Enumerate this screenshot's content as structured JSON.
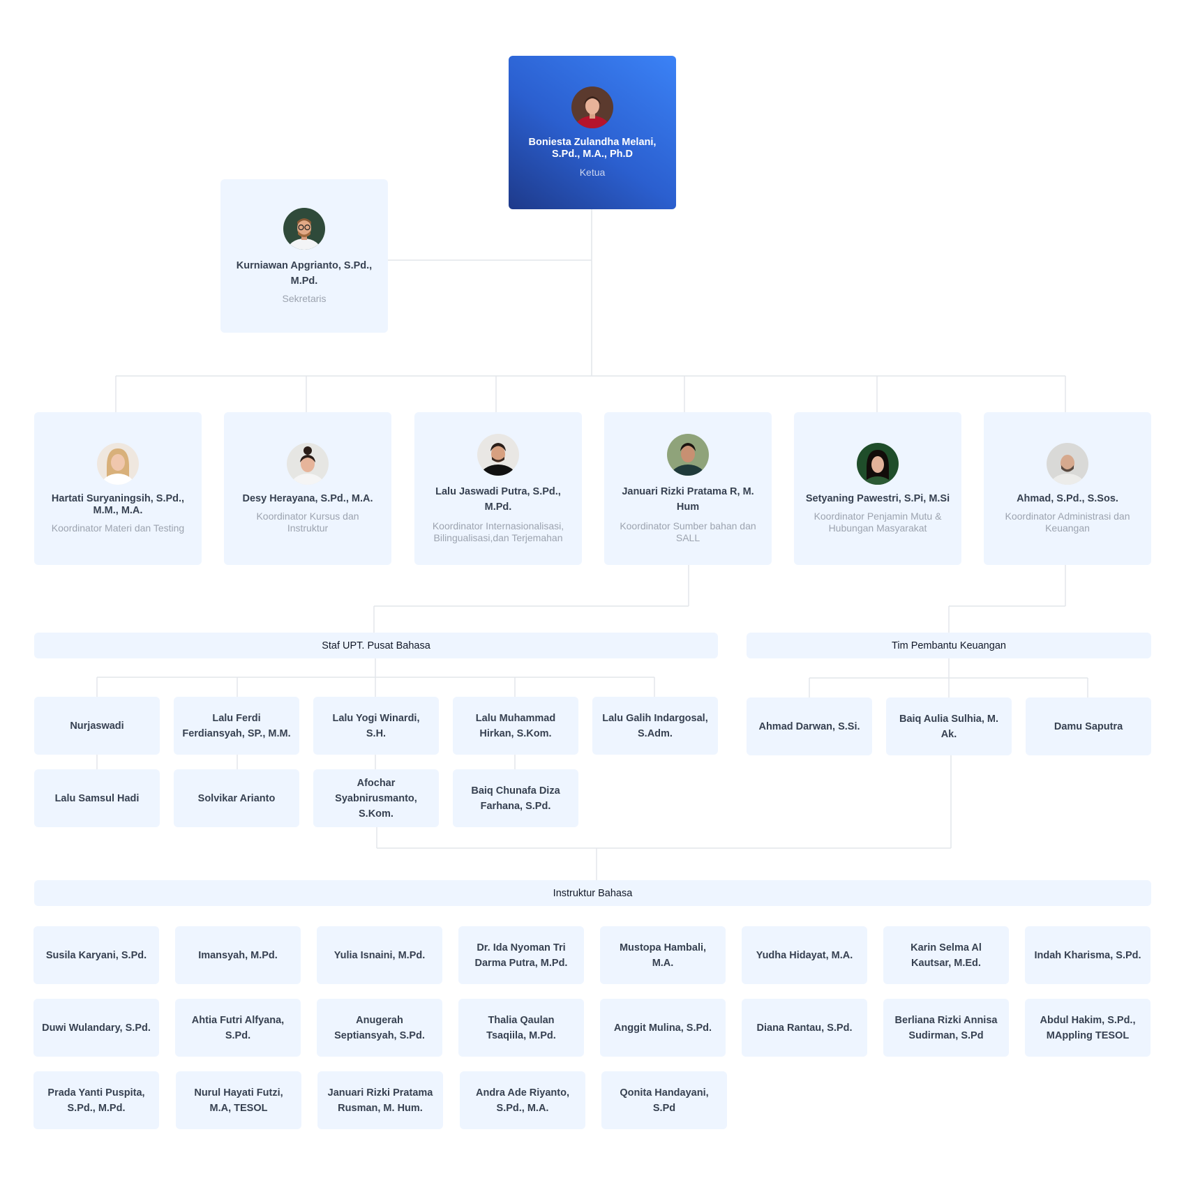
{
  "ketua": {
    "name": "Boniesta Zulandha Melani, S.Pd., M.A., Ph.D",
    "role": "Ketua",
    "avatar": "avatar-woman-red-top"
  },
  "sekretaris": {
    "name": "Kurniawan Apgrianto, S.Pd., M.Pd.",
    "role": "Sekretaris",
    "avatar": "avatar-man-glasses"
  },
  "koordinator": [
    {
      "name": "Hartati Suryaningsih, S.Pd., M.M., M.A.",
      "role": "Koordinator Materi dan Testing",
      "avatar": "avatar-woman-blonde"
    },
    {
      "name": "Desy Herayana, S.Pd., M.A.",
      "role": "Koordinator Kursus dan Instruktur",
      "avatar": "avatar-woman-bun"
    },
    {
      "name": "Lalu Jaswadi Putra, S.Pd., M.Pd.",
      "role": "Koordinator Internasionalisasi, Bilingualisasi,dan Terjemahan",
      "avatar": "avatar-man-black-shirt"
    },
    {
      "name": "Januari Rizki Pratama R, M. Hum",
      "role": "Koordinator Sumber bahan dan SALL",
      "avatar": "avatar-man-outdoor"
    },
    {
      "name": "Setyaning Pawestri, S.Pi, M.Si",
      "role": "Koordinator Penjamin Mutu & Hubungan Masyarakat",
      "avatar": "avatar-woman-leaves"
    },
    {
      "name": "Ahmad, S.Pd., S.Sos.",
      "role": "Koordinator Administrasi dan Keuangan",
      "avatar": "avatar-man-grey"
    }
  ],
  "staf": {
    "title": "Staf UPT. Pusat Bahasa",
    "members": [
      "Nurjaswadi",
      "Lalu Ferdi Ferdiansyah, SP., M.M.",
      "Lalu Yogi Winardi, S.H.",
      "Lalu Muhammad Hirkan, S.Kom.",
      "Lalu Galih Indargosal, S.Adm.",
      "Lalu Samsul Hadi",
      "Solvikar Arianto",
      "Afochar Syabnirusmanto, S.Kom.",
      "Baiq Chunafa Diza Farhana, S.Pd."
    ]
  },
  "keuangan": {
    "title": "Tim Pembantu Keuangan",
    "members": [
      "Ahmad Darwan, S.Si.",
      "Baiq Aulia Sulhia, M. Ak.",
      "Damu Saputra"
    ]
  },
  "instruktur": {
    "title": "Instruktur Bahasa",
    "members": [
      "Susila Karyani, S.Pd.",
      "Imansyah, M.Pd.",
      "Yulia Isnaini, M.Pd.",
      "Dr. Ida Nyoman Tri Darma Putra, M.Pd.",
      "Mustopa Hambali, M.A.",
      "Yudha Hidayat, M.A.",
      "Karin Selma Al Kautsar, M.Ed.",
      "Indah Kharisma, S.Pd.",
      "Duwi Wulandary, S.Pd.",
      "Ahtia Futri Alfyana, S.Pd.",
      "Anugerah Septiansyah, S.Pd.",
      "Thalia Qaulan Tsaqiila, M.Pd.",
      "Anggit Mulina, S.Pd.",
      "Diana Rantau, S.Pd.",
      "Berliana Rizki Annisa Sudirman, S.Pd",
      "Abdul Hakim, S.Pd., MAppling TESOL",
      "Prada Yanti Puspita, S.Pd., M.Pd.",
      "Nurul Hayati Futzi, M.A, TESOL",
      "Januari Rizki Pratama Rusman, M. Hum.",
      "Andra Ade Riyanto, S.Pd., M.A.",
      "Qonita Handayani, S.Pd"
    ]
  },
  "colors": {
    "card_bg": "#eef5ff",
    "top_card_gradient_start": "#3b82f6",
    "top_card_gradient_end": "#1e3a8a",
    "connector": "#e2e5ea"
  }
}
